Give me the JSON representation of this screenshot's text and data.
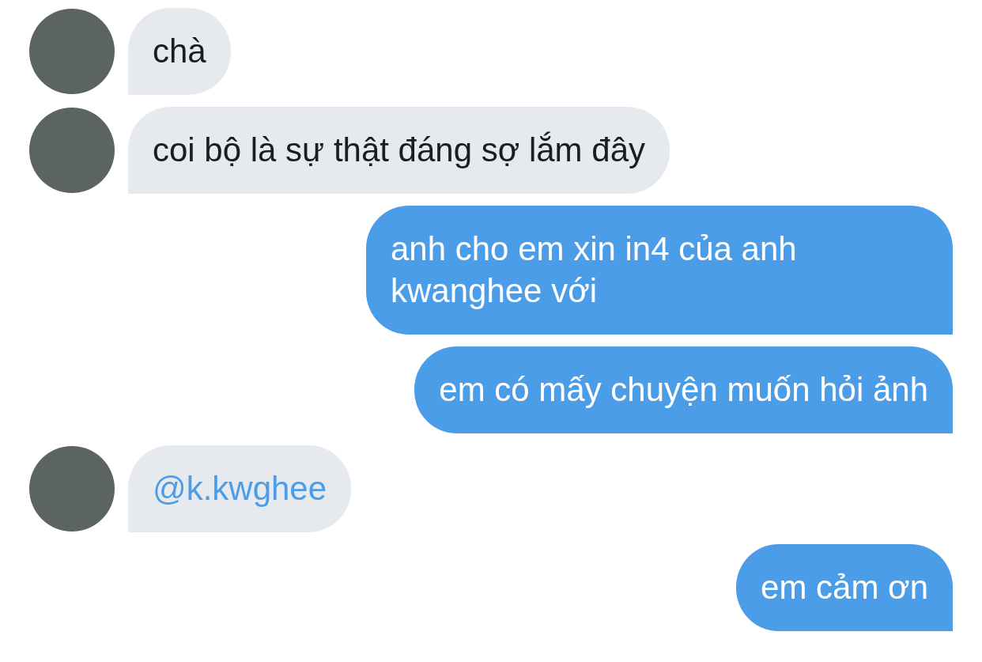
{
  "messages": [
    {
      "outgoing": false,
      "kind": "text",
      "text": "chà"
    },
    {
      "outgoing": false,
      "kind": "text",
      "text": "coi bộ là sự thật đáng sợ lắm đây"
    },
    {
      "outgoing": true,
      "kind": "text",
      "text": "anh cho em xin in4 của anh kwanghee với"
    },
    {
      "outgoing": true,
      "kind": "text",
      "text": "em có mấy chuyện muốn hỏi ảnh"
    },
    {
      "outgoing": false,
      "kind": "link",
      "text": "@k.kwghee"
    },
    {
      "outgoing": true,
      "kind": "text",
      "text": "em cảm ơn"
    }
  ]
}
